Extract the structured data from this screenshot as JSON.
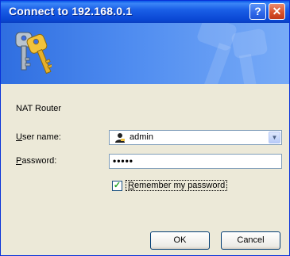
{
  "window": {
    "title": "Connect to 192.168.0.1",
    "help_glyph": "?",
    "close_glyph": "✕"
  },
  "dialog": {
    "realm": "NAT Router",
    "username": {
      "label_initial": "U",
      "label_rest": "ser name:",
      "value": "admin"
    },
    "password": {
      "label_initial": "P",
      "label_rest": "assword:",
      "value": "•••••"
    },
    "remember": {
      "label_initial": "R",
      "label_rest": "emember my password",
      "checked": true
    }
  },
  "buttons": {
    "ok": "OK",
    "cancel": "Cancel"
  },
  "colors": {
    "titlebar": "#0a47d4",
    "face": "#ece9d8",
    "border": "#0831d9"
  },
  "icons": [
    "keys-icon",
    "user-icon",
    "chevron-down-icon",
    "help-icon",
    "close-icon",
    "checkmark-icon"
  ]
}
